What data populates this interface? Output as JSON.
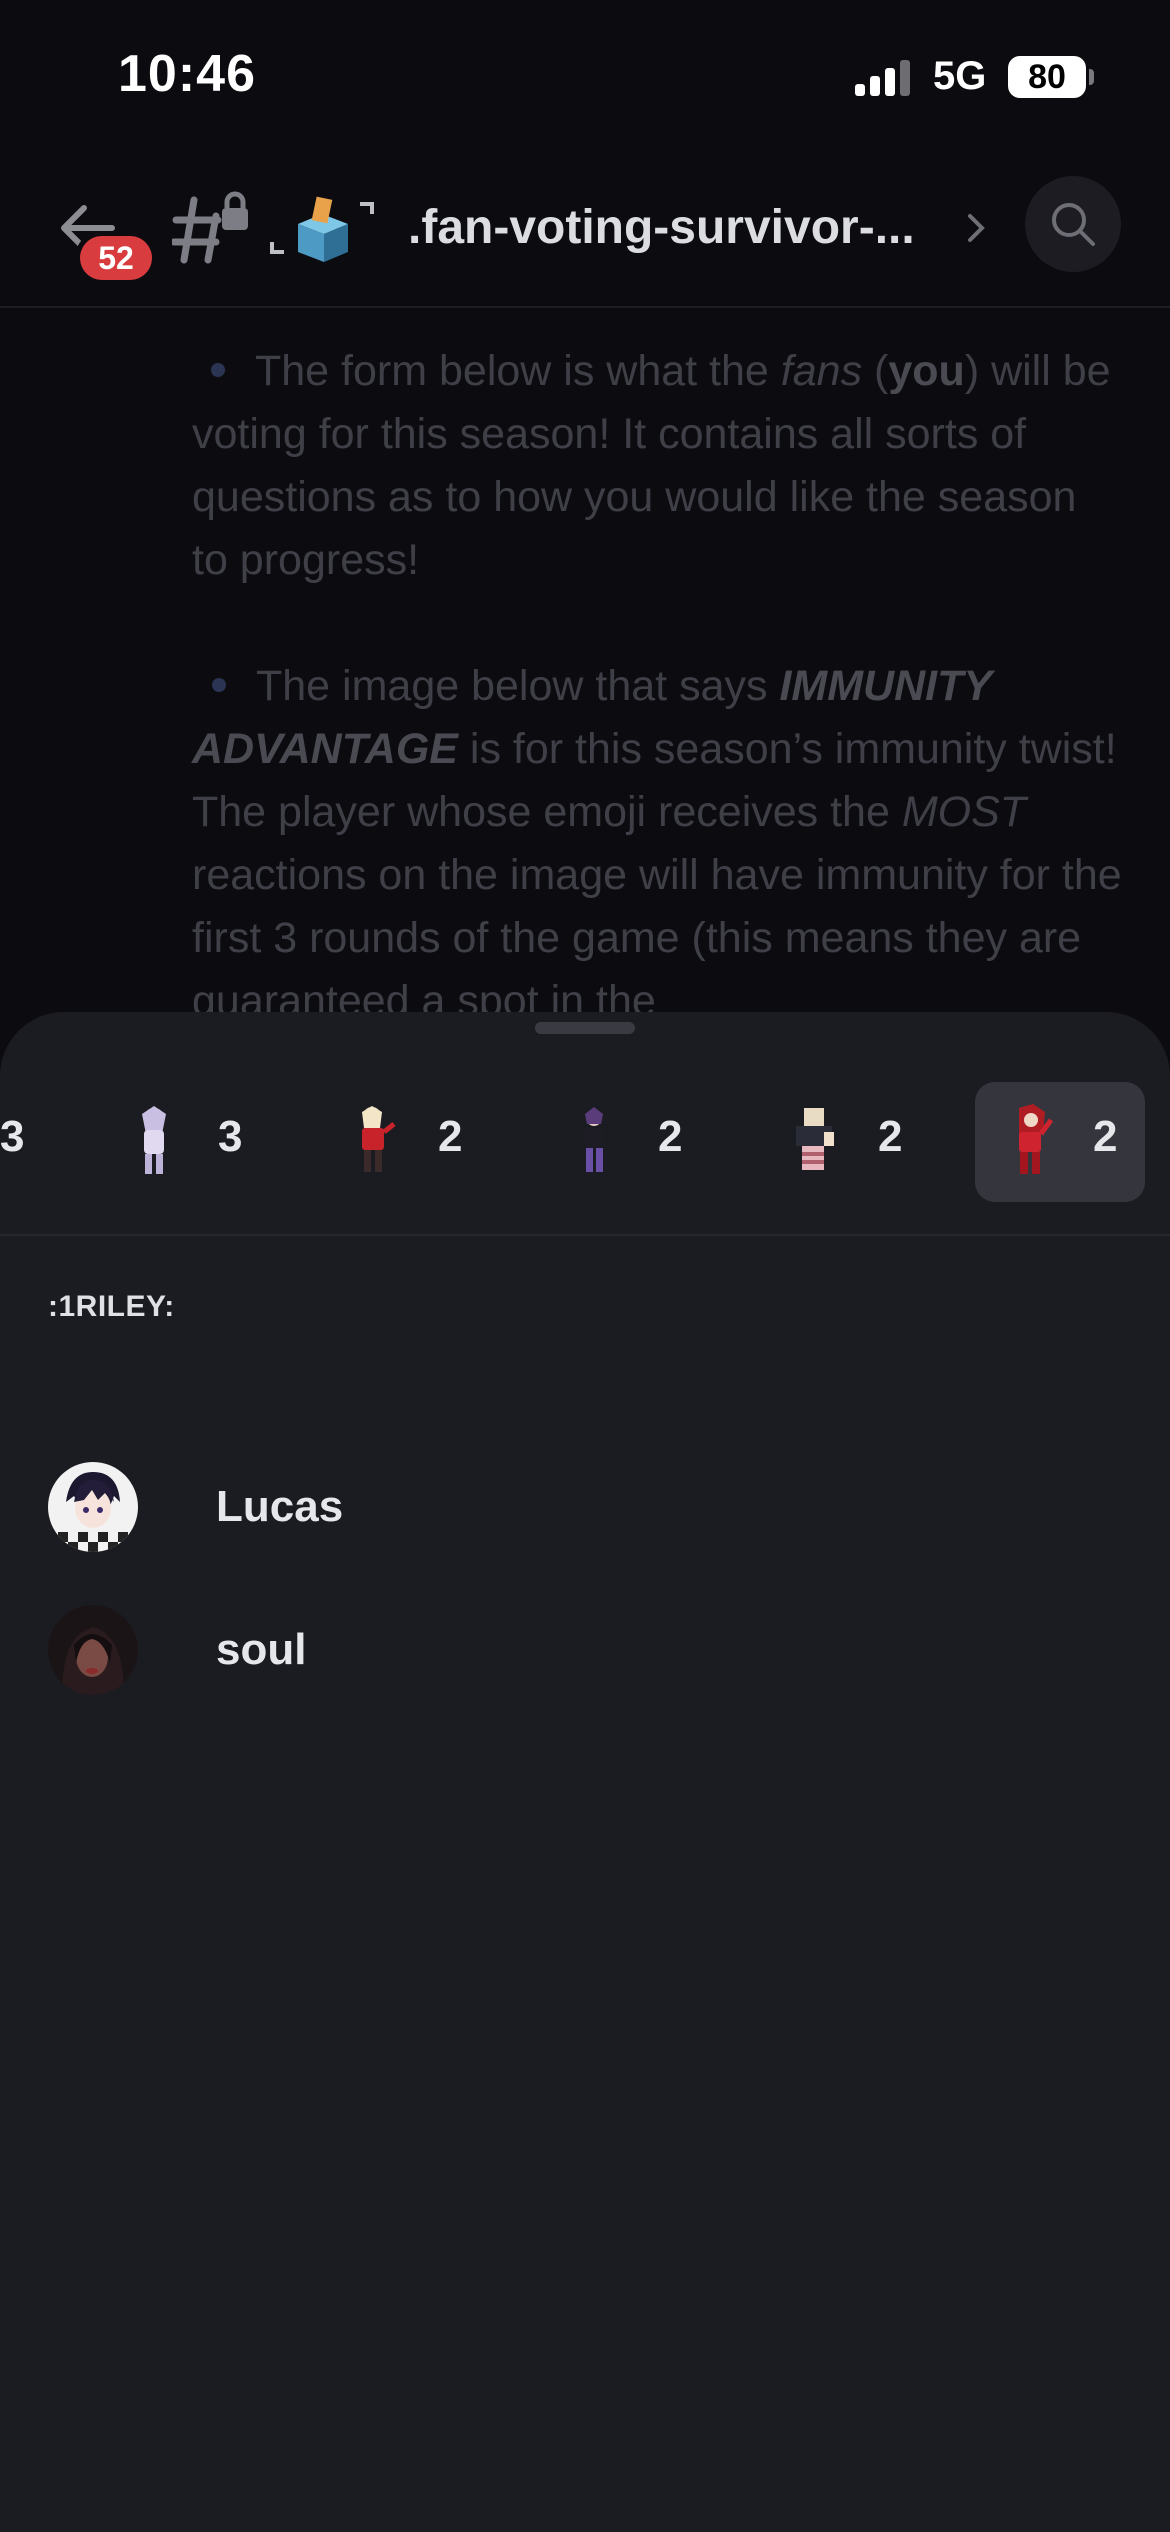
{
  "status_bar": {
    "time": "10:46",
    "network": "5G",
    "battery": "80"
  },
  "header": {
    "back_badge": "52",
    "channel_name": ".fan-voting-survivor-...",
    "accent_badge_color": "#d83c3e"
  },
  "message": {
    "para1_pre": "The form below is what the ",
    "para1_fans": "fans",
    "para1_mid": " (",
    "para1_you": "you",
    "para1_post": ") will be voting for this season! It contains all sorts of questions as to how you would like the season to progress!",
    "para2_pre": "The image below that says ",
    "para2_bold": "IMMUNITY ADVANTAGE",
    "para2_mid": " is for this season’s immunity twist!  The player whose emoji receives the ",
    "para2_most": "MOST",
    "para2_post": " reactions on the image will have immunity for the first 3 rounds of the game (this means they are guaranteed a spot in the"
  },
  "reactions": [
    {
      "emoji": "partial-avatar-emoji",
      "count": "3"
    },
    {
      "emoji": "lavender-avatar-emoji",
      "count": "3"
    },
    {
      "emoji": "red-dress-avatar-emoji",
      "count": "2"
    },
    {
      "emoji": "purple-outfit-avatar-emoji",
      "count": "2"
    },
    {
      "emoji": "blocky-avatar-emoji",
      "count": "2"
    },
    {
      "emoji": "red-hair-avatar-emoji",
      "count": "2",
      "selected": true
    }
  ],
  "selected_emoji_name": ":1RILEY:",
  "users": [
    {
      "name": "Lucas",
      "avatar": "checkered-anime-avatar"
    },
    {
      "name": "soul",
      "avatar": "dark-photo-avatar"
    }
  ]
}
